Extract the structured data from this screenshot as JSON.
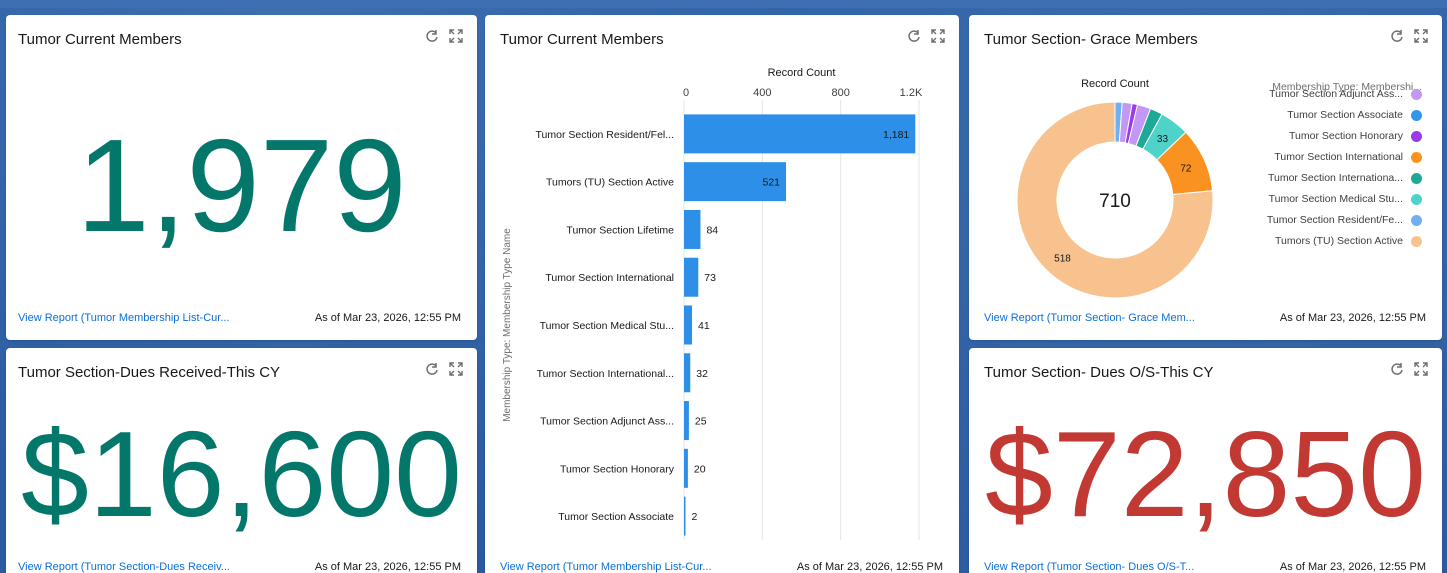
{
  "cards": {
    "current_members_metric": {
      "title": "Tumor Current Members",
      "value": "1,979",
      "color": "#04776b",
      "link": "View Report (Tumor Membership List-Cur...",
      "asof": "As of Mar 23, 2026, 12:55 PM"
    },
    "current_members_chart": {
      "title": "Tumor Current Members",
      "link": "View Report (Tumor Membership List-Cur...",
      "asof": "As of Mar 23, 2026, 12:55 PM"
    },
    "grace_members": {
      "title": "Tumor Section- Grace Members",
      "link": "View Report (Tumor Section- Grace Mem...",
      "asof": "As of Mar 23, 2026, 12:55 PM",
      "center_label": "Record Count",
      "center_value": "710",
      "legend_title": "Membership Type: Membershi...",
      "legend": [
        {
          "label": "Tumor Section Adjunct Ass...",
          "color": "#c398f5"
        },
        {
          "label": "Tumor Section Associate",
          "color": "#3296ed"
        },
        {
          "label": "Tumor Section Honorary",
          "color": "#9b3ae9"
        },
        {
          "label": "Tumor Section International",
          "color": "#f99221"
        },
        {
          "label": "Tumor Section Internationa...",
          "color": "#1ea896"
        },
        {
          "label": "Tumor Section Medical Stu...",
          "color": "#4fd2c8"
        },
        {
          "label": "Tumor Section Resident/Fe...",
          "color": "#6fb0f5"
        },
        {
          "label": "Tumors (TU) Section Active",
          "color": "#f7c28e"
        }
      ]
    },
    "dues_received": {
      "title": "Tumor Section-Dues Received-This CY",
      "value": "$16,600",
      "color": "#04776b",
      "link": "View Report (Tumor Section-Dues Receiv...",
      "asof": "As of Mar 23, 2026, 12:55 PM"
    },
    "dues_outstanding": {
      "title": "Tumor Section- Dues O/S-This CY",
      "value": "$72,850",
      "color": "#c23934",
      "link": "View Report (Tumor Section- Dues O/S-T...",
      "asof": "As of Mar 23, 2026, 12:55 PM"
    }
  },
  "chart_data": [
    {
      "type": "bar",
      "orientation": "horizontal",
      "title": "",
      "xlabel": "Record Count",
      "ylabel": "Membership Type: Membership Type Name",
      "x_ticks": [
        "0",
        "400",
        "800",
        "1.2K"
      ],
      "xlim": [
        0,
        1200
      ],
      "grid": true,
      "color": "#2e8fe8",
      "categories": [
        "Tumor Section Resident/Fel...",
        "Tumors (TU) Section Active",
        "Tumor Section Lifetime",
        "Tumor Section International",
        "Tumor Section Medical Stu...",
        "Tumor Section International...",
        "Tumor Section Adjunct Ass...",
        "Tumor Section Honorary",
        "Tumor Section Associate"
      ],
      "values": [
        1181,
        521,
        84,
        73,
        41,
        32,
        25,
        20,
        2
      ],
      "value_labels": [
        "1,181",
        "521",
        "84",
        "73",
        "41",
        "32",
        "25",
        "20",
        "2"
      ]
    },
    {
      "type": "pie",
      "donut": true,
      "title": "Record Count",
      "total": 710,
      "categories": [
        "Tumor Section Resident/Fe...",
        "Tumor Section Adjunct Ass...",
        "Tumor Section Honorary",
        "Tumor Section Adjunct Ass...",
        "Tumor Section Internationa...",
        "Tumor Section Medical Stu...",
        "Tumor Section International",
        "Tumors (TU) Section Active"
      ],
      "values": [
        8,
        11,
        6,
        15,
        14,
        33,
        72,
        518
      ],
      "colors": [
        "#6fb0f5",
        "#c398f5",
        "#9b3ae9",
        "#c398f5",
        "#1ea896",
        "#4fd2c8",
        "#f99221",
        "#f7c28e"
      ],
      "value_labels": [
        "",
        "",
        "",
        "",
        "",
        "33",
        "72",
        "518"
      ]
    }
  ]
}
